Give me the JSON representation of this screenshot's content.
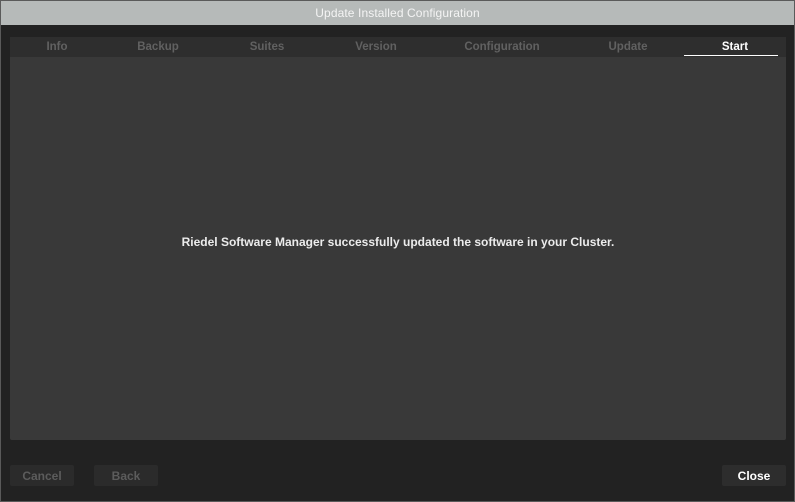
{
  "window": {
    "title": "Update Installed Configuration"
  },
  "tabs": [
    {
      "label": "Info",
      "active": false
    },
    {
      "label": "Backup",
      "active": false
    },
    {
      "label": "Suites",
      "active": false
    },
    {
      "label": "Version",
      "active": false
    },
    {
      "label": "Configuration",
      "active": false
    },
    {
      "label": "Update",
      "active": false
    },
    {
      "label": "Start",
      "active": true
    }
  ],
  "main": {
    "message": "Riedel Software Manager successfully updated the software in your Cluster."
  },
  "footer": {
    "cancel_label": "Cancel",
    "back_label": "Back",
    "close_label": "Close"
  },
  "colors": {
    "titlebar": "#b6bab9",
    "panel": "#393939",
    "background": "#222222",
    "active_tab_text": "#ffffff",
    "inactive_tab_text": "#616161"
  }
}
